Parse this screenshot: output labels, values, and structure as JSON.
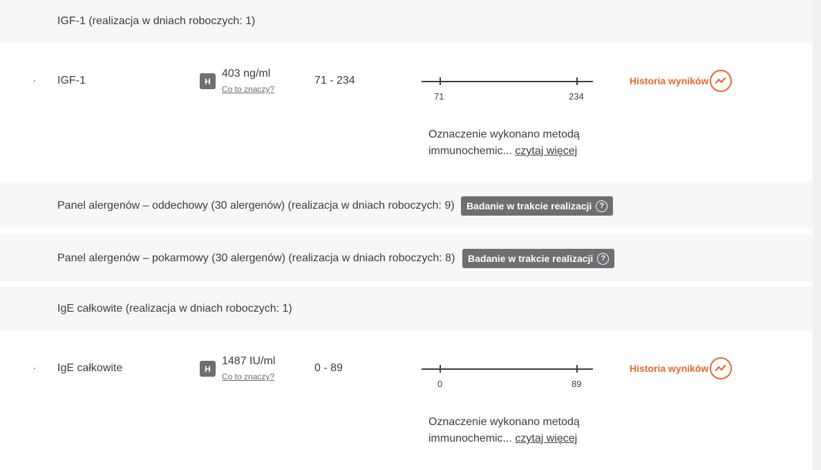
{
  "colors": {
    "accent": "#e8672b",
    "badge_bg": "#6e6e73",
    "header_bg": "#f7f7f7",
    "text": "#3c3c3c"
  },
  "sections": [
    {
      "title": "IGF-1 (realizacja w dniach roboczych: 1)"
    },
    {
      "title": "Panel alergenów – oddechowy (30 alergenów) (realizacja w dniach roboczych: 9)",
      "badge": "Badanie w trakcie realizacji",
      "badge_icon": "question-circle-icon"
    },
    {
      "title": "Panel alergenów – pokarmowy (30 alergenów) (realizacja w dniach roboczych: 8)",
      "badge": "Badanie w trakcie realizacji",
      "badge_icon": "question-circle-icon"
    },
    {
      "title": "IgE całkowite (realizacja w dniach roboczych: 1)"
    }
  ],
  "results": [
    {
      "name": "IGF-1",
      "flag": "H",
      "value": "403 ng/ml",
      "what_link": "Co to znaczy?",
      "range": "71 - 234",
      "scale_min": "71",
      "scale_max": "234",
      "history_label": "Historia wyników",
      "history_icon": "trend-chart-icon",
      "note_line1": "Oznaczenie wykonano metodą",
      "note_line2": "immunochemic...",
      "note_more": "czytaj więcej"
    },
    {
      "name": "IgE całkowite",
      "flag": "H",
      "value": "1487 IU/ml",
      "what_link": "Co to znaczy?",
      "range": "0 - 89",
      "scale_min": "0",
      "scale_max": "89",
      "history_label": "Historia wyników",
      "history_icon": "trend-chart-icon",
      "note_line1": "Oznaczenie wykonano metodą",
      "note_line2": "immunochemic...",
      "note_more": "czytaj więcej"
    }
  ]
}
